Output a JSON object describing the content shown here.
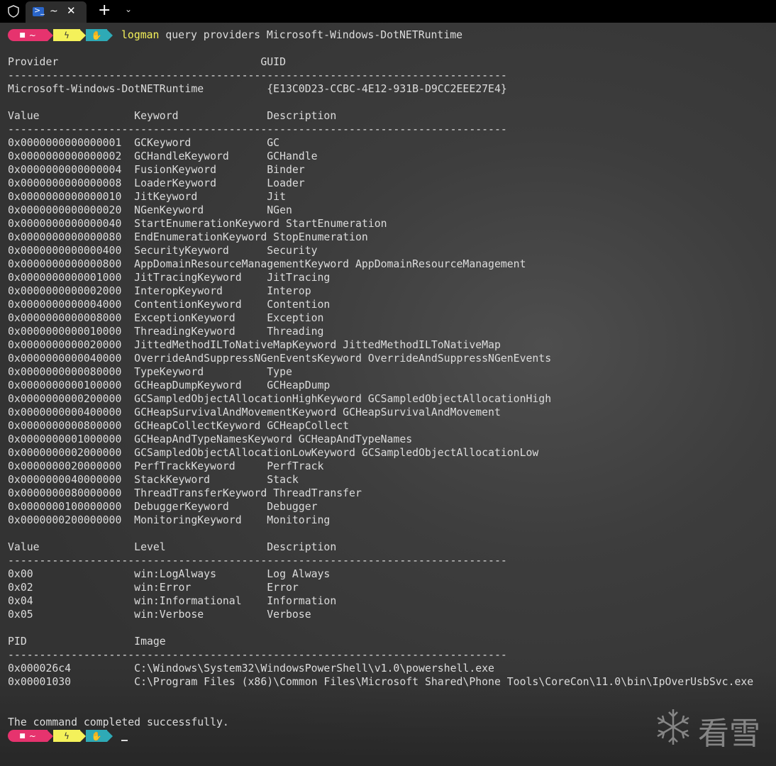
{
  "tab": {
    "title": "~",
    "close_glyph": "✕",
    "icon": "powershell-icon"
  },
  "tabbar": {
    "new_tab_glyph": "+",
    "dropdown_glyph": "⌄"
  },
  "prompt": {
    "folder_glyph": "■",
    "home_glyph": "~",
    "bolt_glyph": "ϟ",
    "hand_glyph": "✋"
  },
  "command": {
    "name": "logman",
    "args": " query providers Microsoft-Windows-DotNETRuntime"
  },
  "lines": [
    "",
    "Provider                                GUID",
    "-------------------------------------------------------------------------------",
    "Microsoft-Windows-DotNETRuntime          {E13C0D23-CCBC-4E12-931B-D9CC2EEE27E4}",
    "",
    "Value               Keyword              Description",
    "-------------------------------------------------------------------------------",
    "0x0000000000000001  GCKeyword            GC",
    "0x0000000000000002  GCHandleKeyword      GCHandle",
    "0x0000000000000004  FusionKeyword        Binder",
    "0x0000000000000008  LoaderKeyword        Loader",
    "0x0000000000000010  JitKeyword           Jit",
    "0x0000000000000020  NGenKeyword          NGen",
    "0x0000000000000040  StartEnumerationKeyword StartEnumeration",
    "0x0000000000000080  EndEnumerationKeyword StopEnumeration",
    "0x0000000000000400  SecurityKeyword      Security",
    "0x0000000000000800  AppDomainResourceManagementKeyword AppDomainResourceManagement",
    "0x0000000000001000  JitTracingKeyword    JitTracing",
    "0x0000000000002000  InteropKeyword       Interop",
    "0x0000000000004000  ContentionKeyword    Contention",
    "0x0000000000008000  ExceptionKeyword     Exception",
    "0x0000000000010000  ThreadingKeyword     Threading",
    "0x0000000000020000  JittedMethodILToNativeMapKeyword JittedMethodILToNativeMap",
    "0x0000000000040000  OverrideAndSuppressNGenEventsKeyword OverrideAndSuppressNGenEvents",
    "0x0000000000080000  TypeKeyword          Type",
    "0x0000000000100000  GCHeapDumpKeyword    GCHeapDump",
    "0x0000000000200000  GCSampledObjectAllocationHighKeyword GCSampledObjectAllocationHigh",
    "0x0000000000400000  GCHeapSurvivalAndMovementKeyword GCHeapSurvivalAndMovement",
    "0x0000000000800000  GCHeapCollectKeyword GCHeapCollect",
    "0x0000000001000000  GCHeapAndTypeNamesKeyword GCHeapAndTypeNames",
    "0x0000000002000000  GCSampledObjectAllocationLowKeyword GCSampledObjectAllocationLow",
    "0x0000000020000000  PerfTrackKeyword     PerfTrack",
    "0x0000000040000000  StackKeyword         Stack",
    "0x0000000080000000  ThreadTransferKeyword ThreadTransfer",
    "0x0000000100000000  DebuggerKeyword      Debugger",
    "0x0000000200000000  MonitoringKeyword    Monitoring",
    "",
    "Value               Level                Description",
    "-------------------------------------------------------------------------------",
    "0x00                win:LogAlways        Log Always",
    "0x02                win:Error            Error",
    "0x04                win:Informational    Information",
    "0x05                win:Verbose          Verbose",
    "",
    "PID                 Image",
    "-------------------------------------------------------------------------------",
    "0x000026c4          C:\\Windows\\System32\\WindowsPowerShell\\v1.0\\powershell.exe",
    "0x00001030          C:\\Program Files (x86)\\Common Files\\Microsoft Shared\\Phone Tools\\CoreCon\\11.0\\bin\\IpOverUsbSvc.exe",
    "",
    "",
    "The command completed successfully."
  ],
  "watermark": {
    "text": "看雪",
    "icon": "snowflake-icon"
  }
}
